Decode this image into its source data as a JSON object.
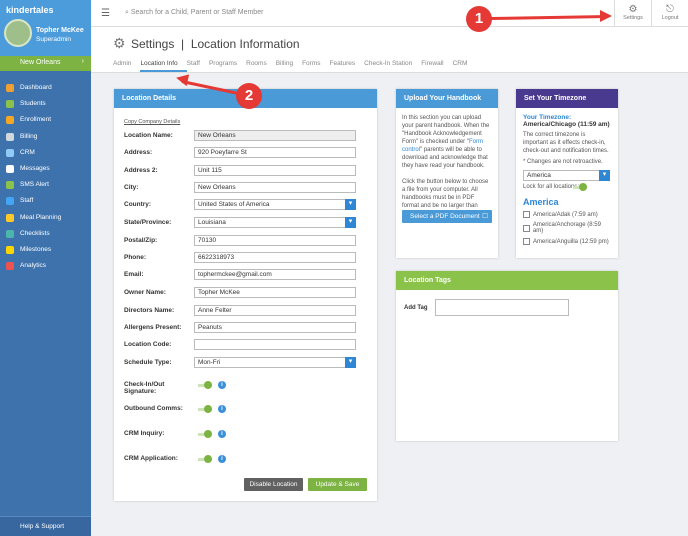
{
  "app": {
    "logo": "kindertales",
    "user_name": "Topher McKee",
    "user_role": "Superadmin",
    "location": "New Orleans"
  },
  "sidebar": {
    "items": [
      {
        "label": "Dashboard",
        "color": "#f0a030"
      },
      {
        "label": "Students",
        "color": "#8bc34a"
      },
      {
        "label": "Enrollment",
        "color": "#f5a623"
      },
      {
        "label": "Billing",
        "color": "#cfd8dc"
      },
      {
        "label": "CRM",
        "color": "#90caf9"
      },
      {
        "label": "Messages",
        "color": "#ffffff"
      },
      {
        "label": "SMS Alert",
        "color": "#8bc34a"
      },
      {
        "label": "Staff",
        "color": "#42a5f5"
      },
      {
        "label": "Meal Planning",
        "color": "#ffca28"
      },
      {
        "label": "Checklists",
        "color": "#4db6ac"
      },
      {
        "label": "Milestones",
        "color": "#ffd600"
      },
      {
        "label": "Analytics",
        "color": "#ef5350"
      }
    ],
    "help": "Help & Support"
  },
  "topbar": {
    "search_placeholder": "Search for a Child, Parent or Staff Member",
    "settings": "Settings",
    "logout": "Logout"
  },
  "header": {
    "title": "Settings",
    "subtitle": "Location Information",
    "tabs": [
      "Admin",
      "Location Info",
      "Staff",
      "Programs",
      "Rooms",
      "Billing",
      "Forms",
      "Features",
      "Check-In Station",
      "Firewall",
      "CRM"
    ],
    "active_tab": "Location Info"
  },
  "location": {
    "title": "Location Details",
    "copy_link": "Copy Company Details",
    "fields": [
      {
        "label": "Location Name:",
        "value": "New Orleans",
        "gray": true
      },
      {
        "label": "Address:",
        "value": "920 Poeyfarre St"
      },
      {
        "label": "Address 2:",
        "value": "Unit 115"
      },
      {
        "label": "City:",
        "value": "New Orleans"
      },
      {
        "label": "Country:",
        "value": "United States of America",
        "select": true
      },
      {
        "label": "State/Province:",
        "value": "Louisiana",
        "select": true
      },
      {
        "label": "Postal/Zip:",
        "value": "70130"
      },
      {
        "label": "Phone:",
        "value": "6622318973"
      },
      {
        "label": "Email:",
        "value": "tophermckee@gmail.com"
      },
      {
        "label": "Owner Name:",
        "value": "Topher McKee"
      },
      {
        "label": "Directors Name:",
        "value": "Anne Felter"
      },
      {
        "label": "Allergens Present:",
        "value": "Peanuts"
      },
      {
        "label": "Location Code:",
        "value": ""
      },
      {
        "label": "Schedule Type:",
        "value": "Mon-Fri",
        "select": true
      }
    ],
    "toggles": [
      {
        "label": "Check-In/Out Signature:",
        "on": true
      },
      {
        "label": "Outbound Comms:",
        "on": true
      },
      {
        "label": "CRM Inquiry:",
        "on": true
      },
      {
        "label": "CRM Application:",
        "on": true
      }
    ],
    "disable": "Disable Location",
    "save": "Update & Save"
  },
  "handbook": {
    "title": "Upload Your Handbook",
    "p1a": "In this section you can upload your parent handbook. When the \"Handbook Acknowledgement Form\" is checked under \"",
    "link": "Form control",
    "p1b": "\" parents will be able to download and acknowledge that they have read your handbook.",
    "p2": "Click the button below to choose a file from your computer. All handbooks must be in PDF format and be no larger than 5MB.",
    "button": "Select a PDF Document"
  },
  "timezone": {
    "title": "Set Your Timezone",
    "label": "Your Timezone:",
    "value": "America/Chicago (11:59 am)",
    "desc": "The correct timezone is important as it effects check-in, check-out and notification times.",
    "note": "* Changes are not retroactive.",
    "region": "America",
    "lock": "Lock for all locations:",
    "heading": "America",
    "options": [
      "America/Adak (7:59 am)",
      "America/Anchorage (8:59 am)",
      "America/Anguilla (12:59 pm)"
    ]
  },
  "tags": {
    "title": "Location Tags",
    "add": "Add Tag"
  },
  "annotations": [
    "1",
    "2"
  ],
  "colors": {
    "sidebar": "#3d72ad",
    "green": "#7cb342",
    "blue": "#4a9ad8",
    "purple": "#4a3a8f",
    "red": "#e53935"
  }
}
